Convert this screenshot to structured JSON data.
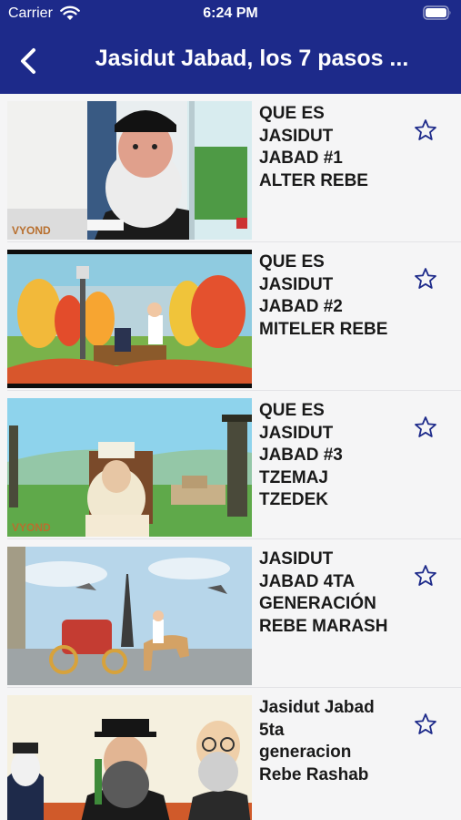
{
  "status_bar": {
    "carrier": "Carrier",
    "time": "6:24 PM",
    "icons": [
      "wifi-icon",
      "battery-icon"
    ]
  },
  "nav": {
    "title": "Jasidut Jabad, los 7 pasos ...",
    "back_icon": "chevron-left-icon",
    "background": "#1d2a8a"
  },
  "videos": [
    {
      "title": "QUE ES\nJASIDUT\nJABAD #1\nALTER REBE",
      "favorite_icon": "star-outline-icon"
    },
    {
      "title": "QUE ES\nJASIDUT\nJABAD #2\nMITELER REBE",
      "favorite_icon": "star-outline-icon"
    },
    {
      "title": "QUE ES\nJASIDUT\nJABAD  #3\nTZEMAJ\nTZEDEK",
      "favorite_icon": "star-outline-icon"
    },
    {
      "title": "JASIDUT\nJABAD 4TA\nGENERACIÓN\nREBE MARASH",
      "favorite_icon": "star-outline-icon"
    },
    {
      "title": "Jasidut Jabad\n5ta\ngeneracion\nRebe Rashab",
      "favorite_icon": "star-outline-icon"
    }
  ],
  "colors": {
    "accent": "#1d2a8a",
    "star": "#1d2a8a"
  }
}
